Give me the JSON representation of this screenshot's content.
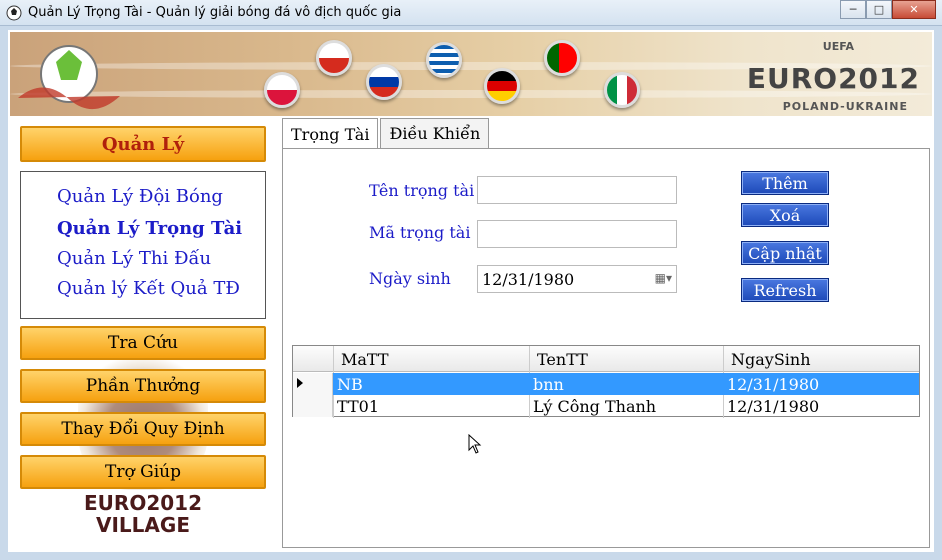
{
  "window": {
    "title": "Quản Lý Trọng Tài - Quản lý giải bóng đá vô địch quốc gia",
    "minimize": "─",
    "maximize": "□",
    "close": "✕"
  },
  "banner": {
    "uefa": "UEFA",
    "logo": "EURO2012",
    "sub": "POLAND-UKRAINE"
  },
  "nav": {
    "header": "Quản Lý",
    "links": [
      "Quản Lý Đội Bóng",
      "Quản Lý Trọng Tài",
      "Quản Lý Thi Đấu",
      "Quản lý Kết Quả TĐ"
    ],
    "buttons": [
      "Tra Cứu",
      "Phần Thưởng",
      "Thay Đổi Quy Định",
      "Trợ Giúp"
    ],
    "village_line1": "EURO2012",
    "village_line2": "VILLAGE"
  },
  "tabs": [
    "Trọng Tài",
    "Điều Khiển"
  ],
  "form": {
    "name_label": "Tên trọng tài",
    "name_value": "",
    "id_label": "Mã trọng tài",
    "id_value": "",
    "dob_label": "Ngày sinh",
    "dob_value": "12/31/1980"
  },
  "actions": [
    "Thêm",
    "Xoá",
    "Cập nhật",
    "Refresh"
  ],
  "grid": {
    "columns": [
      "MaTT",
      "TenTT",
      "NgaySinh"
    ],
    "rows": [
      [
        "NB",
        "bnn",
        "12/31/1980"
      ],
      [
        "TT01",
        "Lý Công Thanh",
        "12/31/1980"
      ]
    ]
  },
  "colors": {
    "accent": "#f6a10f",
    "link": "#1c1cc8",
    "selection": "#3399ff",
    "button": "#1d49b8"
  }
}
